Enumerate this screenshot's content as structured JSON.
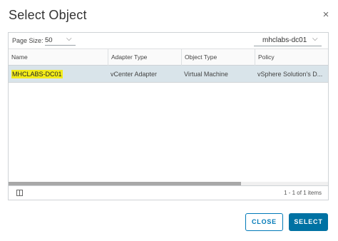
{
  "dialog": {
    "title": "Select Object",
    "close_glyph": "×"
  },
  "toolbar": {
    "page_size_label": "Page Size:",
    "page_size_value": "50",
    "page_size_caret": "⌵",
    "filter_value": "mhclabs-dc01",
    "filter_caret": "⌵"
  },
  "table": {
    "columns": [
      "Name",
      "Adapter Type",
      "Object Type",
      "Policy"
    ],
    "rows": [
      {
        "name": "MHCLABS-DC01",
        "adapter_type": "vCenter Adapter",
        "object_type": "Virtual Machine",
        "policy": "vSphere Solution's D..."
      }
    ],
    "highlight_color": "#f3ec1a",
    "selected_row_color": "#d9e4ea"
  },
  "footer": {
    "count_text": "1 - 1 of 1 items"
  },
  "buttons": {
    "close_label": "CLOSE",
    "select_label": "SELECT",
    "accent_color": "#0079b8"
  }
}
